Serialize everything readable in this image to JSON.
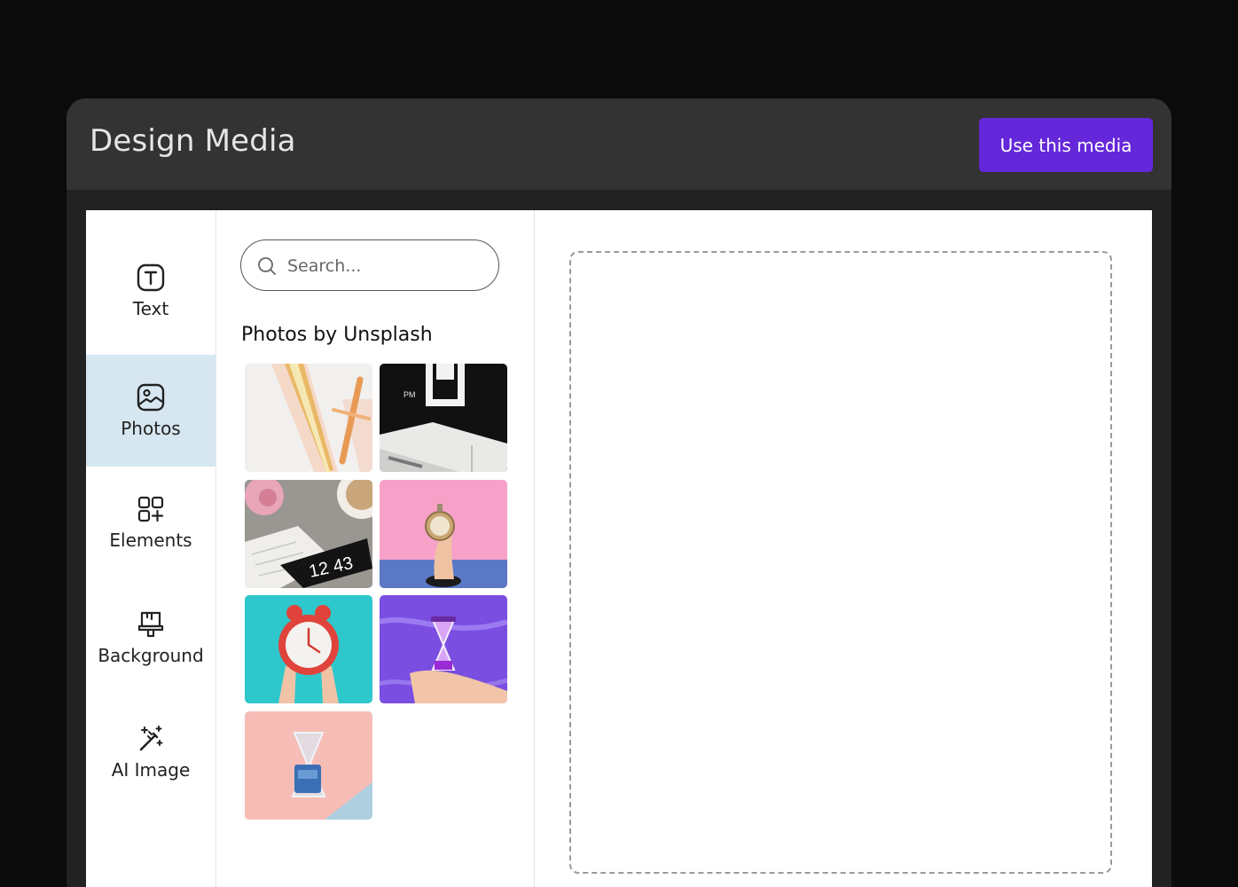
{
  "header": {
    "title": "Design Media",
    "use_button_label": "Use this media",
    "accent_color": "#6427d9"
  },
  "sidebar": {
    "items": [
      {
        "label": "Text",
        "icon": "text-icon"
      },
      {
        "label": "Photos",
        "icon": "photo-icon",
        "active": true
      },
      {
        "label": "Elements",
        "icon": "elements-icon"
      },
      {
        "label": "Background",
        "icon": "background-icon"
      },
      {
        "label": "AI Image",
        "icon": "magic-wand-icon"
      }
    ],
    "active_color": "#d6e7f1"
  },
  "media": {
    "search_placeholder": "Search...",
    "section_title": "Photos by Unsplash",
    "photos": [
      {
        "id": "photo-pens",
        "time_text": ""
      },
      {
        "id": "photo-flip-clock",
        "time_text": "PM"
      },
      {
        "id": "photo-desk-clock",
        "time_text": "12 43"
      },
      {
        "id": "photo-pocket-watch",
        "time_text": ""
      },
      {
        "id": "photo-alarm-clock",
        "time_text": ""
      },
      {
        "id": "photo-hourglass-hand",
        "time_text": ""
      },
      {
        "id": "photo-hourglass-pink",
        "time_text": ""
      }
    ]
  }
}
